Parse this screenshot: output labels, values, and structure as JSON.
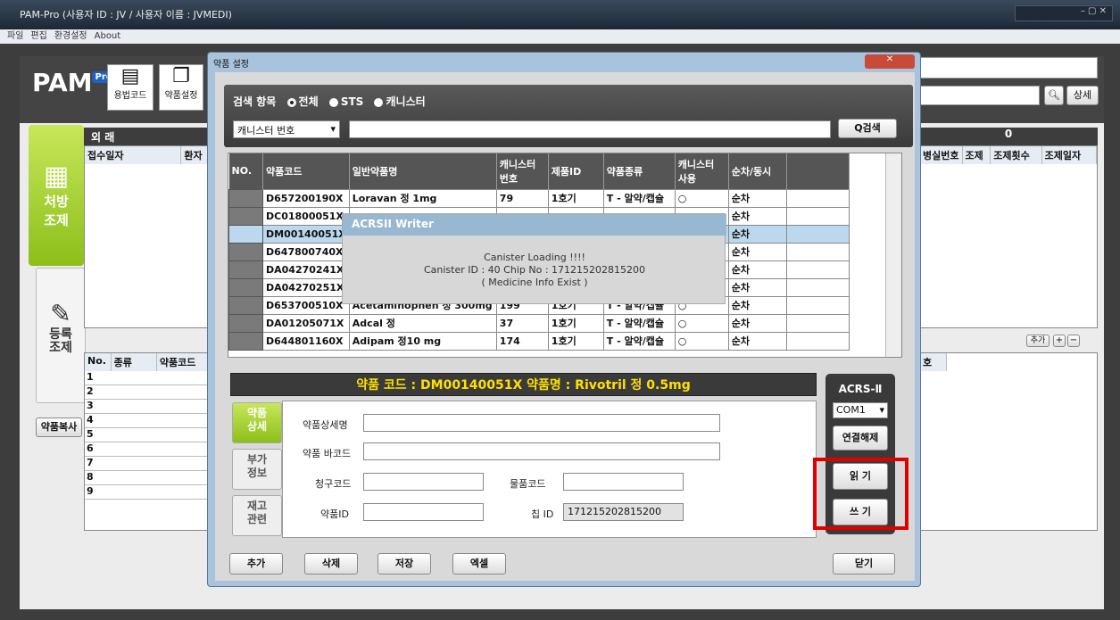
{
  "window": {
    "title": "PAM-Pro (사용자 ID : JV / 사용자 이름 : JVMEDI)"
  },
  "menu": [
    "파일",
    "편집",
    "환경설정",
    "About"
  ],
  "logo": {
    "text": "PAM",
    "badge": "Pro"
  },
  "toolbar": {
    "dose_code": "용법코드",
    "drug_setting": "약품설정",
    "detail": "상세"
  },
  "left": {
    "prescription": "처방\n조제",
    "register": "등록\n조제",
    "copy": "약품복사"
  },
  "outpatient": {
    "label": "외 래",
    "count": "0",
    "cols": [
      "접수일자",
      "환자"
    ],
    "right_cols": [
      "병실번호",
      "조제",
      "조제횟수",
      "조제일자"
    ]
  },
  "lower_grid": {
    "cols": [
      "No.",
      "종류",
      "약품코드"
    ],
    "rows": [
      "1",
      "2",
      "3",
      "4",
      "5",
      "6",
      "7",
      "8",
      "9"
    ],
    "right_header": "호"
  },
  "add_controls": "추가",
  "dialog": {
    "title": "약품 설정",
    "search": {
      "label": "검색 항목",
      "options": [
        "전체",
        "STS",
        "캐니스터"
      ],
      "field": "캐니스터 번호",
      "button": "Q검색"
    },
    "columns": [
      "NO.",
      "약품코드",
      "일반약품명",
      "캐니스터 번호",
      "제품ID",
      "약품종류",
      "캐니스터 사용",
      "순차/동시"
    ],
    "rows": [
      {
        "code": "D657200190X",
        "name": "Loravan 정 1mg",
        "can": "79",
        "pid": "1호기",
        "type": "T - 알약/캡슐",
        "use": "○",
        "seq": "순차"
      },
      {
        "code": "DC01800051X",
        "name": "",
        "can": "",
        "pid": "",
        "type": "",
        "use": "",
        "seq": "순차"
      },
      {
        "code": "DM00140051X",
        "name": "",
        "can": "",
        "pid": "",
        "type": "",
        "use": "",
        "seq": "순차"
      },
      {
        "code": "D647800740X",
        "name": "",
        "can": "",
        "pid": "",
        "type": "",
        "use": "",
        "seq": "순차"
      },
      {
        "code": "DA04270241X",
        "name": "",
        "can": "",
        "pid": "",
        "type": "",
        "use": "",
        "seq": "순차"
      },
      {
        "code": "DA04270251X",
        "name": "",
        "can": "",
        "pid": "",
        "type": "",
        "use": "",
        "seq": "순차"
      },
      {
        "code": "D653700510X",
        "name": "Acetaminophen 정 300mg",
        "can": "199",
        "pid": "1호기",
        "type": "T - 알약/캡슐",
        "use": "○",
        "seq": "순차"
      },
      {
        "code": "DA01205071X",
        "name": "Adcal 정",
        "can": "37",
        "pid": "1호기",
        "type": "T - 알약/캡슐",
        "use": "○",
        "seq": "순차"
      },
      {
        "code": "D644801160X",
        "name": "Adipam 정10 mg",
        "can": "174",
        "pid": "1호기",
        "type": "T - 알약/캡슐",
        "use": "○",
        "seq": "순차"
      }
    ],
    "popup": {
      "title": "ACRSII Writer",
      "l1": "Canister Loading !!!!",
      "l2": "Canister ID : 40    Chip No : 171215202815200",
      "l3": "( Medicine Info Exist )"
    },
    "codebar": "약품 코드 : DM00140051X      약품명 : Rivotril 정 0.5mg",
    "tabs": [
      "약품\n상세",
      "부가\n정보",
      "재고\n관련"
    ],
    "fields": {
      "detail_name": "약품상세명",
      "barcode": "약품 바코드",
      "claim": "청구코드",
      "logistics": "물품코드",
      "drug_id": "약품ID",
      "chip_id_label": "칩 ID",
      "chip_id": "171215202815200"
    },
    "acrs": {
      "title": "ACRS-Ⅱ",
      "port": "COM1",
      "disconnect": "연결해제",
      "read": "읽 기",
      "write": "쓰 기"
    },
    "buttons": {
      "add": "추가",
      "delete": "삭제",
      "save": "저장",
      "excel": "엑셀",
      "close": "닫기"
    }
  }
}
